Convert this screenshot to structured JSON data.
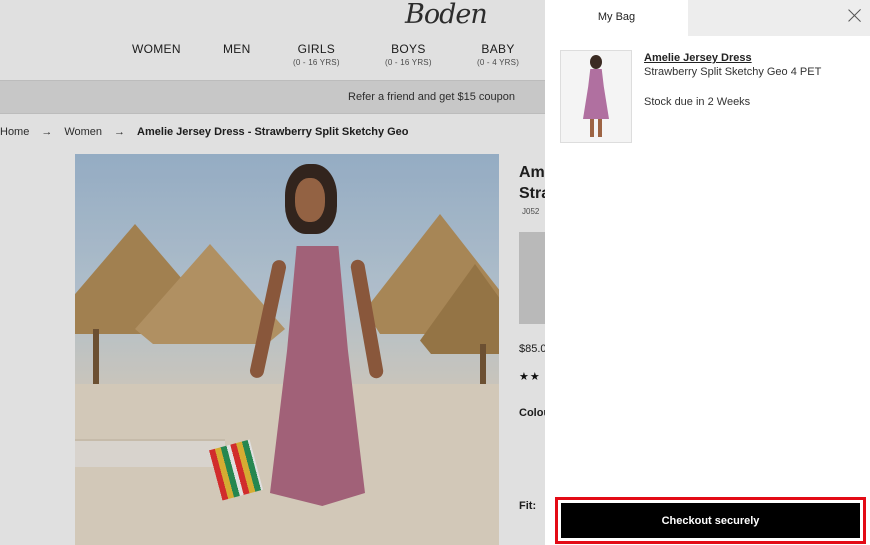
{
  "brand": {
    "logo_text": "Boden"
  },
  "nav": {
    "items": [
      {
        "label": "WOMEN",
        "sub": ""
      },
      {
        "label": "MEN",
        "sub": ""
      },
      {
        "label": "GIRLS",
        "sub": "(0 - 16 YRS)"
      },
      {
        "label": "BOYS",
        "sub": "(0 - 16 YRS)"
      },
      {
        "label": "BABY",
        "sub": "(0 - 4 YRS)"
      }
    ]
  },
  "promo": {
    "text": "Refer a friend and get $15 coupon"
  },
  "breadcrumb": {
    "items": [
      "Home",
      "Women",
      "Amelie Jersey Dress - Strawberry Split Sketchy Geo"
    ],
    "separator": "→"
  },
  "product": {
    "title_line1": "Ame",
    "title_line2": "Stra",
    "code": "J052",
    "price": "$85.0",
    "stars": "★★",
    "colour_label": "Colou",
    "fit_label": "Fit:"
  },
  "bag": {
    "tab_label": "My Bag",
    "item": {
      "name": "Amelie Jersey Dress",
      "variant": "Strawberry Split Sketchy Geo 4 PET",
      "stock": "Stock due in 2 Weeks"
    },
    "checkout_label": "Checkout securely"
  },
  "colors": {
    "checkout_bg": "#000000",
    "highlight": "#e30b16",
    "dress": "#b86f89"
  }
}
